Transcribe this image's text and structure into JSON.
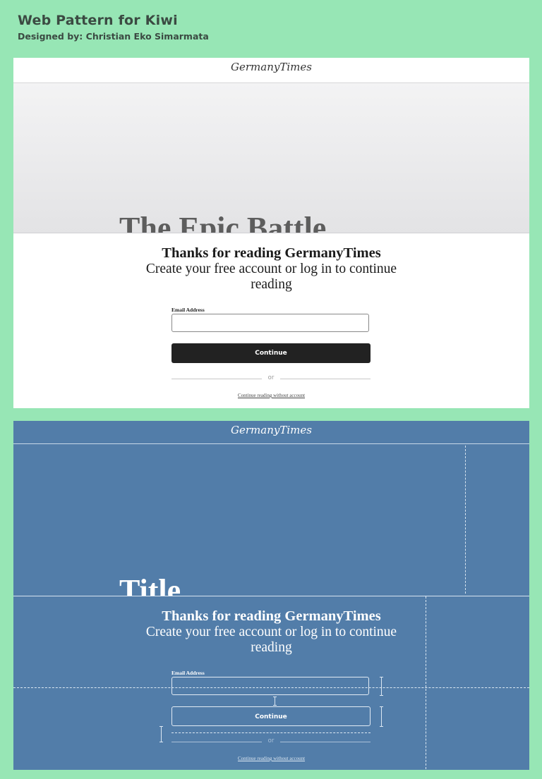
{
  "header": {
    "title": "Web Pattern for Kiwi",
    "subtitle": "Designed by: Christian Eko Simarmata"
  },
  "colors": {
    "background": "#97e6b5",
    "blueprint": "#527da9",
    "button_dark": "#222222"
  },
  "mockup": {
    "logo": "GermanyTimes",
    "hero_title": "The Epic Battle",
    "paywall": {
      "heading": "Thanks for reading GermanyTimes",
      "subheading": "Create your free account or log in to continue reading",
      "email_label": "Email Address",
      "email_value": "",
      "continue_label": "Continue",
      "divider_text": "or",
      "skip_link": "Continue reading without account"
    }
  },
  "blueprint": {
    "logo": "GermanyTimes",
    "hero_title": "Title",
    "paywall": {
      "heading": "Thanks for reading GermanyTimes",
      "subheading": "Create your free account or log in to continue reading",
      "email_label": "Email Address",
      "email_value": "",
      "continue_label": "Continue",
      "divider_text": "or",
      "skip_link": "Continue reading without account"
    }
  }
}
